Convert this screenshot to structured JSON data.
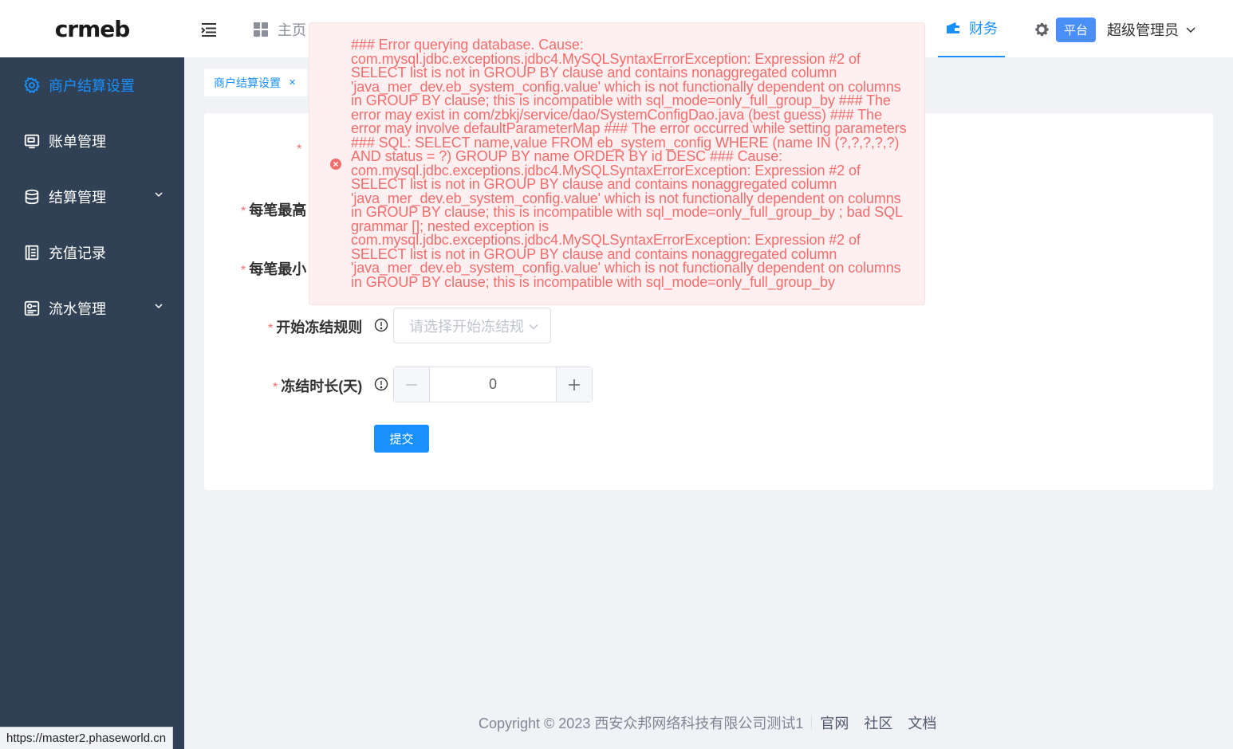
{
  "app": {
    "logo": "crmeb"
  },
  "sidebar": {
    "items": [
      {
        "label": "商户结算设置",
        "icon": "gear-icon",
        "active": true
      },
      {
        "label": "账单管理",
        "icon": "bill-icon"
      },
      {
        "label": "结算管理",
        "icon": "database-icon",
        "expandable": true
      },
      {
        "label": "充值记录",
        "icon": "document-icon"
      },
      {
        "label": "流水管理",
        "icon": "ledger-icon",
        "expandable": true
      }
    ]
  },
  "header": {
    "home_label": "主页",
    "finance_label": "财务",
    "platform_badge": "平台",
    "admin_name": "超级管理员"
  },
  "tags": {
    "active_label": "商户结算设置"
  },
  "form": {
    "fields": [
      {
        "label": "每笔最高"
      },
      {
        "label": "每笔最小"
      }
    ],
    "freeze_rule": {
      "label": "开始冻结规则",
      "placeholder": "请选择开始冻结规"
    },
    "freeze_days": {
      "label": "冻结时长(天)",
      "value": "0"
    },
    "submit_label": "提交"
  },
  "error": {
    "message": "### Error querying database. Cause: com.mysql.jdbc.exceptions.jdbc4.MySQLSyntaxErrorException: Expression #2 of SELECT list is not in GROUP BY clause and contains nonaggregated column 'java_mer_dev.eb_system_config.value' which is not functionally dependent on columns in GROUP BY clause; this is incompatible with sql_mode=only_full_group_by ### The error may exist in com/zbkj/service/dao/SystemConfigDao.java (best guess) ### The error may involve defaultParameterMap ### The error occurred while setting parameters ### SQL: SELECT name,value FROM eb_system_config WHERE (name IN (?,?,?,?,?) AND status = ?) GROUP BY name ORDER BY id DESC ### Cause: com.mysql.jdbc.exceptions.jdbc4.MySQLSyntaxErrorException: Expression #2 of SELECT list is not in GROUP BY clause and contains nonaggregated column 'java_mer_dev.eb_system_config.value' which is not functionally dependent on columns in GROUP BY clause; this is incompatible with sql_mode=only_full_group_by ; bad SQL grammar []; nested exception is com.mysql.jdbc.exceptions.jdbc4.MySQLSyntaxErrorException: Expression #2 of SELECT list is not in GROUP BY clause and contains nonaggregated column 'java_mer_dev.eb_system_config.value' which is not functionally dependent on columns in GROUP BY clause; this is incompatible with sql_mode=only_full_group_by",
    "color": "#f56c6c"
  },
  "footer": {
    "copyright": "Copyright © 2023 西安众邦网络科技有限公司测试1",
    "links": [
      "官网",
      "社区",
      "文档"
    ]
  },
  "status_bar": {
    "url": "https://master2.phaseworld.cn"
  },
  "colors": {
    "accent": "#1890ff",
    "sidebar_bg": "#304156",
    "error": "#f56c6c",
    "badge": "#4a8ef7"
  }
}
